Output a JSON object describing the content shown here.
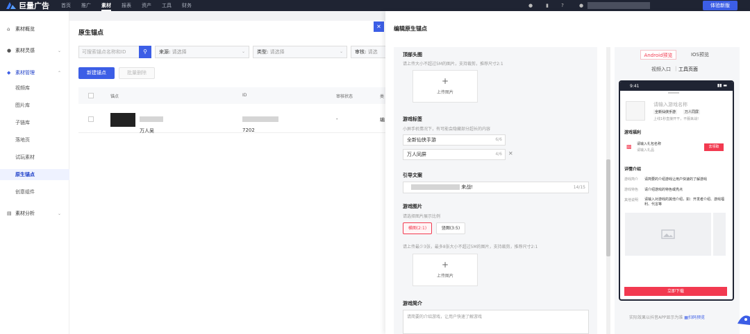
{
  "topbar": {
    "logo_text": "巨量广告",
    "nav": [
      "首页",
      "推广",
      "素材",
      "报表",
      "资产",
      "工具",
      "财务"
    ],
    "active_nav": "素材",
    "trial_button": "体验新版",
    "icons": [
      "bell-icon",
      "phone-icon",
      "help-icon",
      "user-icon"
    ]
  },
  "sidebar": {
    "items": [
      {
        "label": "素材概览",
        "icon": "home-icon"
      },
      {
        "label": "素材灵感",
        "icon": "bulb-icon"
      },
      {
        "label": "素材管理",
        "icon": "layers-icon"
      }
    ],
    "sub_items": [
      "视频库",
      "图片库",
      "子链库",
      "落地页",
      "试玩素材",
      "原生锚点",
      "创意组件"
    ],
    "active_sub": "原生锚点",
    "bottom_item": {
      "label": "素材分析",
      "icon": "chart-icon"
    }
  },
  "main": {
    "title": "原生锚点",
    "search_placeholder": "可搜索锚点名称和ID",
    "filters": [
      {
        "label": "来源:",
        "placeholder": "请选择"
      },
      {
        "label": "类型:",
        "placeholder": "请选择"
      },
      {
        "label": "审核:",
        "placeholder": "请选"
      }
    ],
    "new_button": "新建锚点",
    "batch_delete": "批量删除",
    "table": {
      "headers": [
        "锚点",
        "ID",
        "审核状态",
        "类"
      ],
      "rows": [
        {
          "name": "万人吴",
          "id": "7202",
          "status": "-",
          "type": "编"
        }
      ]
    }
  },
  "drawer": {
    "title": "编辑原生锚点",
    "sections": {
      "top_image": {
        "label": "顶部头图",
        "hint": "请上传大小不超过5M的图片，支持裁剪，推荐尺寸2:1",
        "upload": "上传图片"
      },
      "game_tags": {
        "label": "游戏标签",
        "hint": "小屏手机情况下，有可能会隐藏部分超长的内容",
        "tags": [
          {
            "value": "全新仙侠手游",
            "count": "6/6"
          },
          {
            "value": "万人同屏",
            "count": "4/6"
          }
        ]
      },
      "guide_text": {
        "label": "引导文案",
        "value": "来战!",
        "count": "14/15"
      },
      "game_images": {
        "label": "游戏图片",
        "hint": "请选择图片展示比例",
        "ratios": [
          "横图(2:1)",
          "竖图(3:5)"
        ],
        "selected_ratio": "横图(2:1)",
        "upload_hint": "请上传最少3张，最多8张大小不超过5M的图片，支持裁剪，推荐尺寸2:1",
        "upload": "上传图片"
      },
      "intro": {
        "label": "游戏简介",
        "placeholder": "请简要的介绍游戏，让用户快速了解游戏"
      }
    }
  },
  "preview": {
    "tabs": [
      "Android预览",
      "IOS预览"
    ],
    "active_tab": "Android预览",
    "links": [
      "视频入口",
      "工具页面"
    ],
    "phone_time": "9:41",
    "game_name_placeholder": "请输入游戏名称",
    "tags": [
      "全新仙侠手游",
      "万人同屏"
    ],
    "tagline": "上线1秒直接开干，不服来战!",
    "benefits_title": "游戏福利",
    "gift_name": "请输入礼包名称",
    "gift_sub": "请输入礼品",
    "redeem": "去领取",
    "details_title": "详情介绍",
    "details": [
      {
        "key": "游戏简介",
        "value": "请简要的介绍游戏让用户快速的了解游戏"
      },
      {
        "key": "游戏特色",
        "value": "请介绍游戏的特色或亮点"
      },
      {
        "key": "其他说明",
        "value": "请输入对游戏的其他介绍，如：开发者介绍、游戏福利、代言等"
      }
    ],
    "download": "立即下载",
    "footer_note": "实际效果以抖音APP显示为准",
    "footer_link": "扫码预览"
  },
  "colors": {
    "accent": "#3c5ee6",
    "danger": "#f23a50",
    "topbar": "#1f2433"
  }
}
